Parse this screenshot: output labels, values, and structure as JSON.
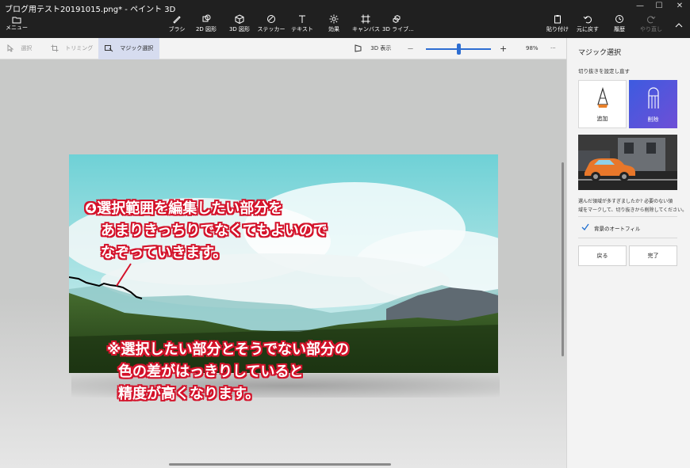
{
  "window": {
    "title": "ブログ用テスト20191015.png* - ペイント 3D",
    "controls": [
      "—",
      "☐",
      "✕"
    ]
  },
  "menu": {
    "label": "メニュー"
  },
  "tools": [
    {
      "label": "ブラシ"
    },
    {
      "label": "2D 図形"
    },
    {
      "label": "3D 図形"
    },
    {
      "label": "ステッカー"
    },
    {
      "label": "テキスト"
    },
    {
      "label": "効果"
    },
    {
      "label": "キャンバス"
    },
    {
      "label": "3D ライブ..."
    }
  ],
  "right_tools": [
    {
      "label": "貼り付け"
    },
    {
      "label": "元に戻す"
    },
    {
      "label": "履歴"
    },
    {
      "label": "やり直し"
    }
  ],
  "toolbar2": {
    "select": "選択",
    "crop": "トリミング",
    "magic": "マジック選択",
    "view3d": "3D 表示",
    "zoom_minus": "—",
    "zoom_plus": "+",
    "zoom_value": "98%",
    "more": "···",
    "zoom_level": 0.5
  },
  "annotations": {
    "step_lines": [
      "❹選択範囲を編集したい部分を",
      "あまりきっちりでなくてもよいので",
      "なぞっていきます。"
    ],
    "note_lines": [
      "※選択したい部分とそうでない部分の",
      "色の差がはっきりしていると",
      "精度が高くなります。"
    ]
  },
  "panel": {
    "title": "マジック選択",
    "subtitle": "切り抜きを設定し直す",
    "add_label": "追加",
    "remove_label": "削除",
    "description": [
      "選んだ領域が多すぎましたか? 必要のない領",
      "域をマークして、切り抜きから削除してください。"
    ],
    "autofill_label": "背景のオートフィル",
    "autofill_checked": true,
    "back_label": "戻る",
    "done_label": "完了"
  },
  "colors": {
    "accent": "#5b4fd8",
    "annotation_red": "#d4122a",
    "title_bg": "#202020"
  }
}
